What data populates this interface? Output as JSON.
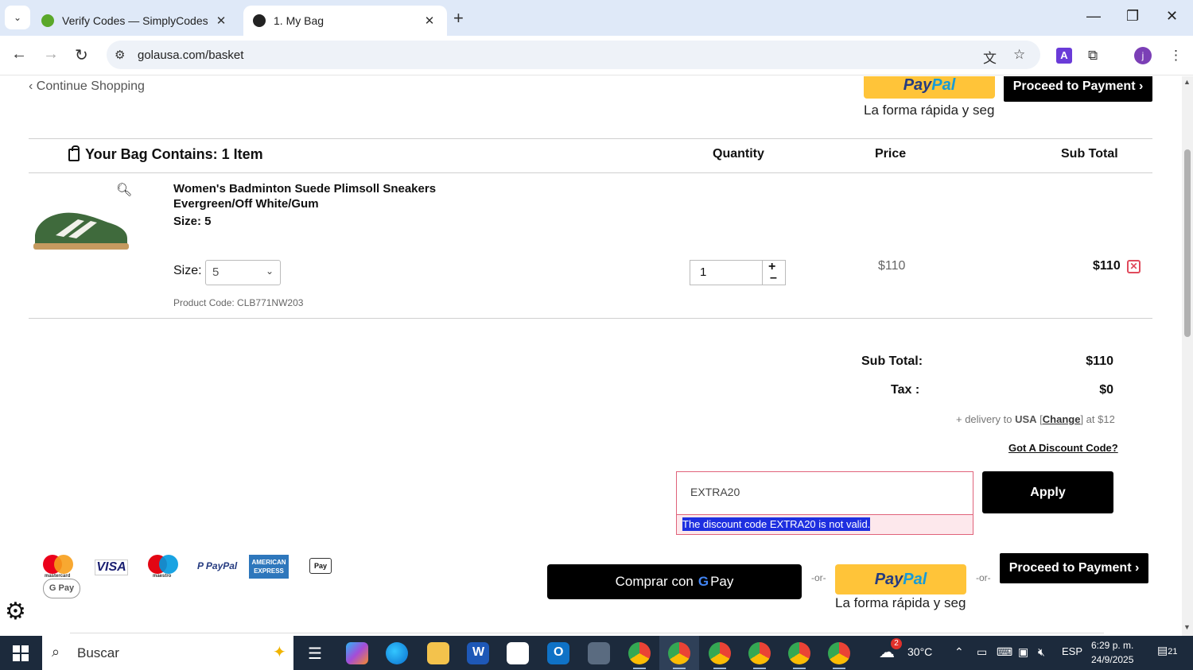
{
  "browser": {
    "tabs": [
      {
        "title": "Verify Codes — SimplyCodes",
        "active": false
      },
      {
        "title": "1. My Bag",
        "active": true
      }
    ],
    "url": "golausa.com/basket",
    "profile_initial": "j",
    "ext_letter": "A"
  },
  "page": {
    "continue_label": "‹ Continue Shopping",
    "paypal_top": {
      "brand_a": "Pay",
      "brand_b": "Pal",
      "tagline": "La forma rápida y seg"
    },
    "proceed_label": "Proceed to Payment ›",
    "bag_heading": "Your Bag Contains: 1 Item",
    "columns": {
      "quantity": "Quantity",
      "price": "Price",
      "subtotal": "Sub Total"
    },
    "item": {
      "name": "Women's Badminton Suede Plimsoll Sneakers Evergreen/Off White/Gum",
      "size_line": "Size: 5",
      "size_label": "Size:",
      "size_selected": "5",
      "product_code": "Product Code: CLB771NW203",
      "quantity": "1",
      "qty_plus": "+",
      "qty_minus": "–",
      "unit_price": "$110",
      "line_total": "$110"
    },
    "summary": {
      "subtotal_label": "Sub Total:",
      "subtotal_value": "$110",
      "tax_label": "Tax :",
      "tax_value": "$0",
      "delivery_prefix": "+ delivery to",
      "delivery_country": "USA",
      "delivery_change": "Change",
      "delivery_suffix": "at $12"
    },
    "discount": {
      "link": "Got A Discount Code?",
      "code_value": "EXTRA20",
      "error": "The discount code EXTRA20 is not valid.",
      "apply_label": "Apply"
    },
    "payment_logos": {
      "mastercard": "mastercard",
      "visa": "VISA",
      "maestro": "maestro",
      "paypal": "P PayPal",
      "amex": "AMERICAN EXPRESS",
      "applepay": "Pay",
      "gpay": "G Pay"
    },
    "gpay_button": {
      "prefix": "Comprar con",
      "g": "G",
      "suffix": "Pay"
    },
    "or_text": "-or-",
    "paypal_bottom": {
      "brand_a": "Pay",
      "brand_b": "Pal",
      "tagline": "La forma rápida y seg"
    }
  },
  "taskbar": {
    "search_placeholder": "Buscar",
    "weather_badge": "2",
    "temperature": "30°C",
    "language": "ESP",
    "time": "6:29 p. m.",
    "date": "24/9/2025",
    "notifications": "21"
  }
}
